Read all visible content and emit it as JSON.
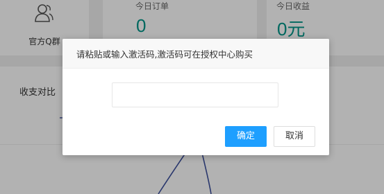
{
  "qq_card": {
    "label": "官方Q群",
    "icon": "users-icon"
  },
  "orders_card": {
    "label": "今日订单",
    "value": "0"
  },
  "income_card": {
    "label": "今日收益",
    "value": "0元"
  },
  "compare_card": {
    "title": "收支对比"
  },
  "dialog": {
    "title": "请粘贴或输入激活码,激活码可在授权中心购买",
    "input_value": "",
    "input_placeholder": "",
    "confirm_label": "确定",
    "cancel_label": "取消"
  },
  "colors": {
    "accent_value": "#009688",
    "primary_button": "#1e9fff",
    "chart_line": "#3c4f9c"
  }
}
